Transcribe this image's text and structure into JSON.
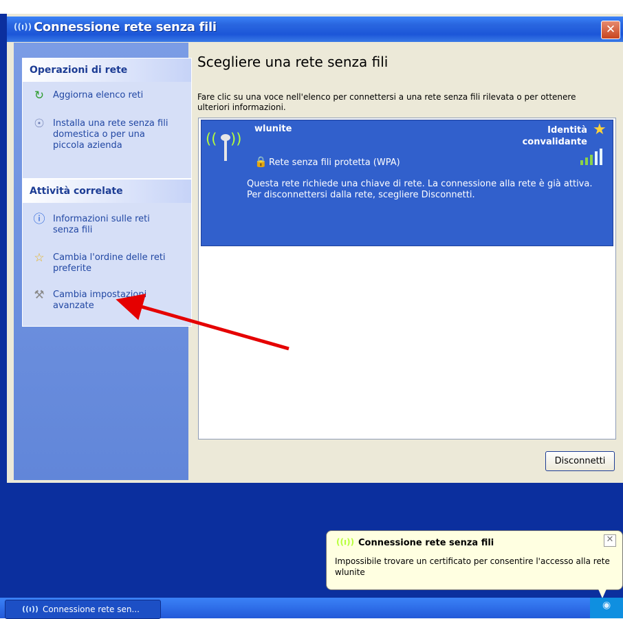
{
  "window": {
    "title": "Connessione rete senza fili",
    "title_icon": "((ı))",
    "close": "✕"
  },
  "sidebar": {
    "groups": [
      {
        "header": "Operazioni di rete",
        "items": [
          {
            "icon": "refresh-icon",
            "glyph": "↻",
            "label": "Aggiorna elenco reti"
          },
          {
            "icon": "setup-network-icon",
            "glyph": "☉",
            "label": "Installa una rete senza fili domestica o per una piccola azienda"
          }
        ]
      },
      {
        "header": "Attività correlate",
        "items": [
          {
            "icon": "info-icon",
            "glyph": "ⓘ",
            "label": "Informazioni sulle reti senza fili"
          },
          {
            "icon": "star-icon",
            "glyph": "☆",
            "label": "Cambia l'ordine delle reti preferite"
          },
          {
            "icon": "wrench-icon",
            "glyph": "⚒",
            "label": "Cambia impostazioni avanzate"
          }
        ]
      }
    ]
  },
  "main": {
    "title": "Scegliere una rete senza fili",
    "instruction": "Fare clic su una voce nell'elenco per connettersi a una rete senza fili rilevata o per ottenere ulteriori informazioni.",
    "network": {
      "name": "wlunite",
      "identity": "Identità convalidante",
      "security": "Rete senza fili protetta (WPA)",
      "description": "Questa rete richiede una chiave di rete. La connessione alla rete è già attiva. Per disconnettersi dalla rete, scegliere Disconnetti.",
      "signal_strength": 5
    },
    "disconnect_label": "Disconnetti"
  },
  "balloon": {
    "title": "Connessione rete senza fili",
    "text": "Impossibile trovare un certificato per consentire l'accesso alla rete wlunite",
    "close": "✕"
  },
  "taskbar": {
    "button_label": "Connessione rete sen...",
    "button_icon": "((ı))"
  },
  "colors": {
    "accent": "#3160cc",
    "annotation_arrow": "#e50000"
  }
}
